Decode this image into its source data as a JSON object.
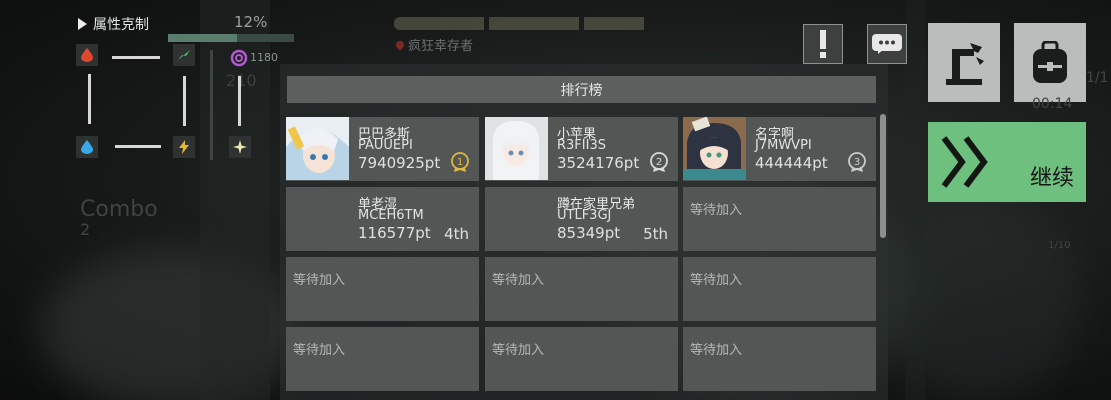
{
  "element_counter": {
    "title": "属性克制",
    "percent": "12%",
    "hp_value": "1180",
    "hp_fill": 0.55,
    "skill_value": "210",
    "icons": [
      "fire-drop-icon",
      "wind-leaf-icon",
      "vortex-icon",
      "water-drop-icon",
      "lightning-icon",
      "sparkle-icon"
    ]
  },
  "combo": {
    "label": "Combo",
    "value": "2"
  },
  "status": {
    "survivor_label": "疯狂幸存者"
  },
  "side_info": {
    "count": "1/1",
    "time": "00:14",
    "counter": "1/10"
  },
  "buttons": {
    "continue_label": "继续"
  },
  "leaderboard": {
    "title": "排行榜",
    "entries": [
      {
        "name": "巴巴多斯",
        "id": "PAUUEPI",
        "score": "7940925pt",
        "rank": "1"
      },
      {
        "name": "小苹果",
        "id": "R3FII3S",
        "score": "3524176pt",
        "rank": "2"
      },
      {
        "name": "名字啊",
        "id": "J7MWVPI",
        "score": "444444pt",
        "rank": "3"
      },
      {
        "name": "单老湿",
        "id": "MCEH6TM",
        "score": "116577pt",
        "rank": "4th"
      },
      {
        "name": "蹲在家里兄弟",
        "id": "UTLF3GJ",
        "score": "85349pt",
        "rank": "5th"
      }
    ],
    "waiting_label": "等待加入"
  },
  "colors": {
    "continue_green": "#6ec07f",
    "panel": "#525655",
    "header": "#5b5f5e"
  }
}
